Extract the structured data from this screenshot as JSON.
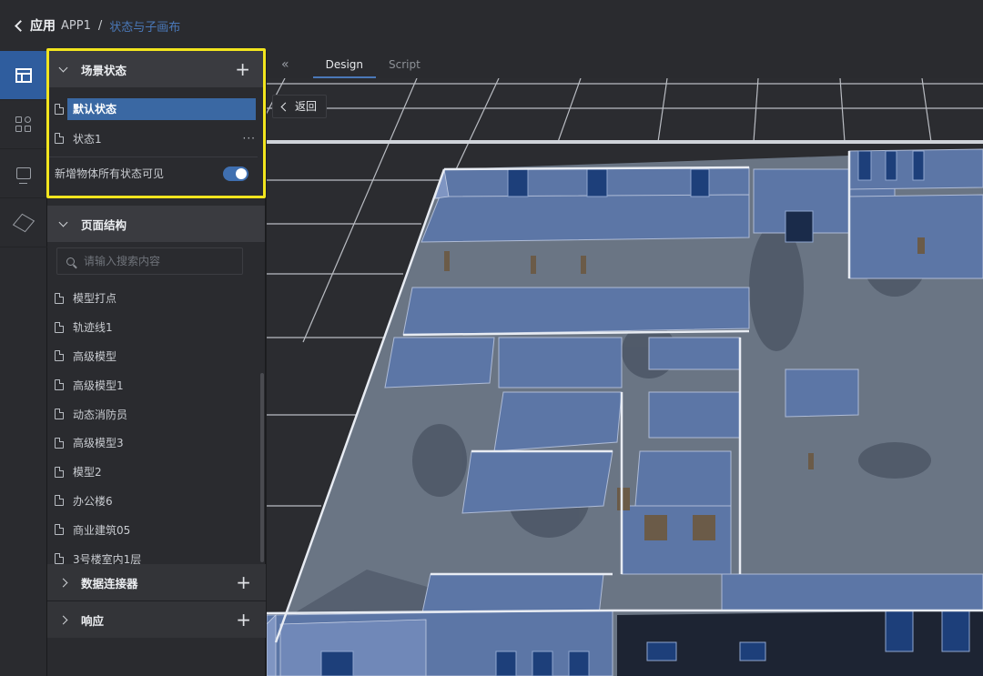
{
  "breadcrumb": {
    "app": "应用",
    "app_name": "APP1",
    "separator": "/",
    "page": "状态与子画布"
  },
  "rail": {
    "items": [
      "layout-icon",
      "components-icon",
      "monitor-icon",
      "cube-icon"
    ],
    "active": "layout-icon"
  },
  "scene_states": {
    "title": "场景状态",
    "items": [
      {
        "label": "默认状态",
        "selected": true
      },
      {
        "label": "状态1",
        "more": "···"
      }
    ],
    "toggle_label": "新增物体所有状态可见",
    "toggle_on": true
  },
  "page_structure": {
    "title": "页面结构",
    "search_placeholder": "请输入搜索内容",
    "items": [
      "模型打点",
      "轨迹线1",
      "高级模型",
      "高级模型1",
      "动态消防员",
      "高级模型3",
      "模型2",
      "办公楼6",
      "商业建筑05",
      "3号楼室内1层"
    ]
  },
  "collapsed_sections": [
    "数据连接器",
    "响应"
  ],
  "editor": {
    "collapse_glyph": "«",
    "tabs": [
      "Design",
      "Script"
    ],
    "active_tab": "Design",
    "back_label": "返回"
  },
  "colors": {
    "accent": "#3a68a3",
    "highlight": "#f2e51e",
    "wall": "#5b73a3",
    "floor": "#6f7a87"
  }
}
